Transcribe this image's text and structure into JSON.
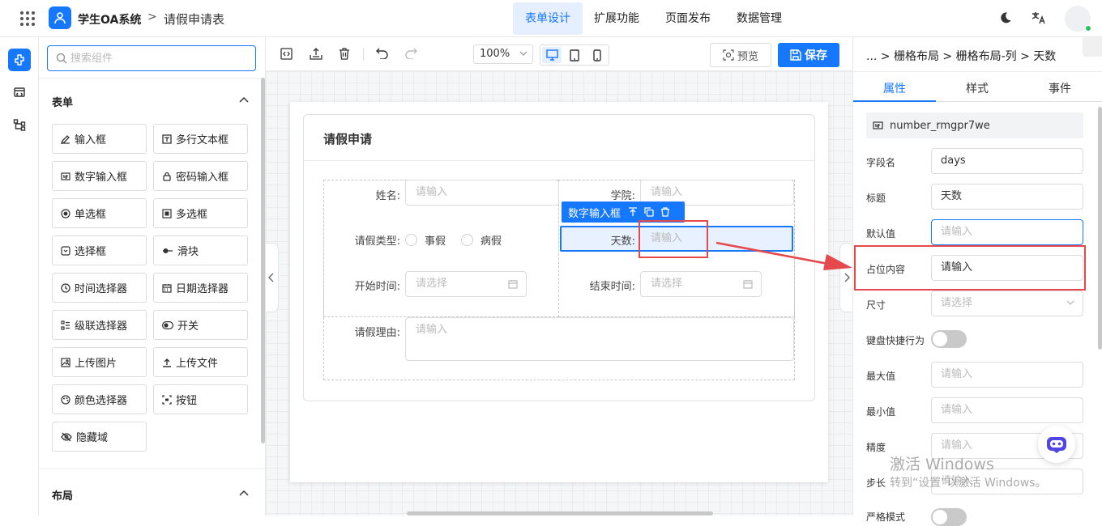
{
  "header": {
    "app_title": "学生OA系统",
    "crumb_sep": ">",
    "page_title": "请假申请表",
    "nav_tabs": [
      {
        "label": "表单设计",
        "active": true
      },
      {
        "label": "扩展功能",
        "active": false
      },
      {
        "label": "页面发布",
        "active": false
      },
      {
        "label": "数据管理",
        "active": false
      }
    ],
    "icons": [
      "apps-grid-icon",
      "user-logo-icon",
      "moon-icon",
      "translate-icon",
      "avatar"
    ]
  },
  "colors": {
    "primary": "#1677ff",
    "annotation_red": "#e5484d",
    "online": "#22c55e"
  },
  "component_panel": {
    "search_placeholder": "搜索组件",
    "section_form": "表单",
    "section_layout": "布局",
    "components": [
      {
        "label": "输入框",
        "icon": "pencil-icon"
      },
      {
        "label": "多行文本框",
        "icon": "textarea-icon"
      },
      {
        "label": "数字输入框",
        "icon": "number-icon"
      },
      {
        "label": "密码输入框",
        "icon": "lock-icon"
      },
      {
        "label": "单选框",
        "icon": "radio-icon"
      },
      {
        "label": "多选框",
        "icon": "checkbox-icon"
      },
      {
        "label": "选择框",
        "icon": "select-icon"
      },
      {
        "label": "滑块",
        "icon": "slider-icon"
      },
      {
        "label": "时间选择器",
        "icon": "clock-icon"
      },
      {
        "label": "日期选择器",
        "icon": "calendar-icon"
      },
      {
        "label": "级联选择器",
        "icon": "cascader-icon"
      },
      {
        "label": "开关",
        "icon": "switch-icon"
      },
      {
        "label": "上传图片",
        "icon": "image-icon"
      },
      {
        "label": "上传文件",
        "icon": "upload-icon"
      },
      {
        "label": "颜色选择器",
        "icon": "palette-icon"
      },
      {
        "label": "按钮",
        "icon": "button-icon"
      },
      {
        "label": "隐藏域",
        "icon": "eye-off-icon"
      }
    ]
  },
  "toolbar": {
    "zoom": "100%",
    "preview_label": "预览",
    "save_label": "保存"
  },
  "form": {
    "title": "请假申请",
    "fields": {
      "name": {
        "label": "姓名:",
        "placeholder": "请输入"
      },
      "college": {
        "label": "学院:",
        "placeholder": "请输入"
      },
      "leave_type": {
        "label": "请假类型:",
        "options": [
          "事假",
          "病假"
        ]
      },
      "days": {
        "label": "天数:",
        "placeholder": "请输入"
      },
      "start_time": {
        "label": "开始时间:",
        "placeholder": "请选择"
      },
      "end_time": {
        "label": "结束时间:",
        "placeholder": "请选择"
      },
      "reason": {
        "label": "请假理由:",
        "placeholder": "请输入"
      }
    },
    "selected_tag": "数字输入框"
  },
  "props_panel": {
    "breadcrumb": "... > 栅格布局 > 栅格布局-列 > 天数",
    "tabs": [
      "属性",
      "样式",
      "事件"
    ],
    "component_id": "number_rmgpr7we",
    "rows": [
      {
        "label": "字段名",
        "value": "days",
        "placeholder": ""
      },
      {
        "label": "标题",
        "value": "天数",
        "placeholder": ""
      },
      {
        "label": "默认值",
        "value": "",
        "placeholder": "请输入"
      },
      {
        "label": "占位内容",
        "value": "请输入",
        "placeholder": ""
      },
      {
        "label": "尺寸",
        "value": "",
        "placeholder": "请选择"
      },
      {
        "label": "键盘快捷行为",
        "toggle": false
      },
      {
        "label": "最大值",
        "value": "",
        "placeholder": "请输入"
      },
      {
        "label": "最小值",
        "value": "",
        "placeholder": "请输入"
      },
      {
        "label": "精度",
        "value": "",
        "placeholder": "请输入"
      },
      {
        "label": "步长",
        "value": "",
        "placeholder": "请输入"
      },
      {
        "label": "严格模式",
        "toggle": false
      }
    ]
  },
  "watermark": {
    "line1": "激活 Windows",
    "line2": "转到“设置”以激活 Windows。"
  }
}
